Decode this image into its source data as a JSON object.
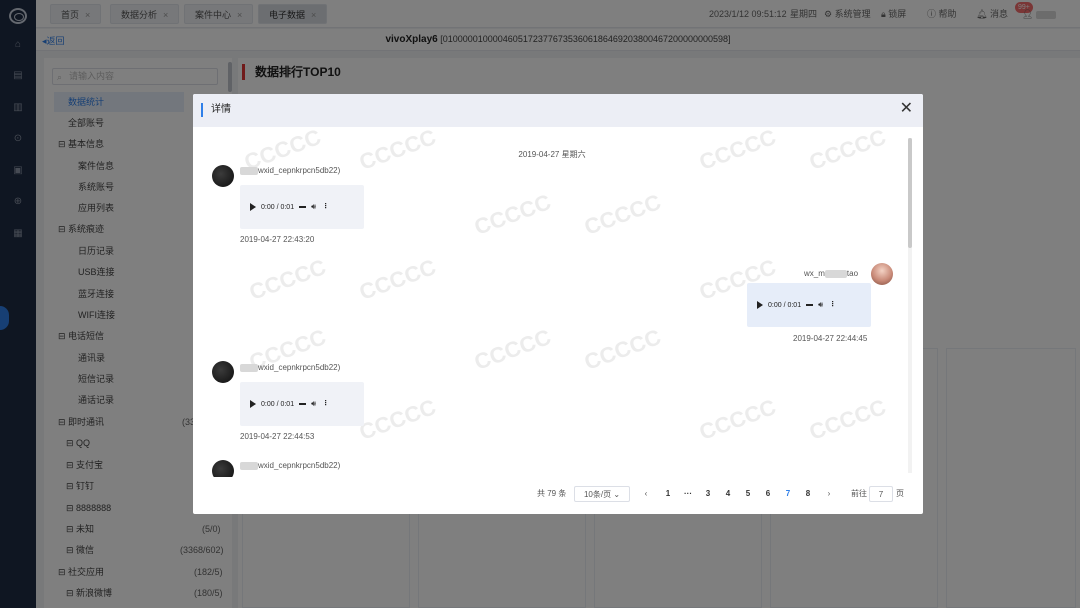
{
  "tabs": [
    {
      "label": "首页",
      "close": "×"
    },
    {
      "label": "数据分析",
      "close": "×"
    },
    {
      "label": "案件中心",
      "close": "×"
    },
    {
      "label": "电子数据",
      "close": "×"
    }
  ],
  "topright": {
    "datetime": "2023/1/12 09:51:12",
    "weekday": "星期四",
    "system": "系统管理",
    "lock": "锁屏",
    "help": "帮助",
    "badge": "99+",
    "message": "消息"
  },
  "subbar": {
    "back": "返回",
    "device_name": "vivoXplay6",
    "device_id": "[010000010000460517237767353606186469203800467200000000598]"
  },
  "search": {
    "placeholder": "请输入内容"
  },
  "tree": [
    {
      "label": "数据统计",
      "count": ""
    },
    {
      "label": "全部账号",
      "count": ""
    },
    {
      "label": "基本信息",
      "count": ""
    },
    {
      "label": "案件信息",
      "count": ""
    },
    {
      "label": "系统账号",
      "count": ""
    },
    {
      "label": "应用列表",
      "count": ""
    },
    {
      "label": "系统痕迹",
      "count": ""
    },
    {
      "label": "日历记录",
      "count": ""
    },
    {
      "label": "USB连接",
      "count": ""
    },
    {
      "label": "蓝牙连接",
      "count": ""
    },
    {
      "label": "WIFI连接",
      "count": ""
    },
    {
      "label": "电话短信",
      "count": ""
    },
    {
      "label": "通讯录",
      "count": ""
    },
    {
      "label": "短信记录",
      "count": ""
    },
    {
      "label": "通话记录",
      "count": ""
    },
    {
      "label": "即时通讯",
      "count": "(33"
    },
    {
      "label": "QQ",
      "count": ""
    },
    {
      "label": "支付宝",
      "count": ""
    },
    {
      "label": "钉钉",
      "count": ""
    },
    {
      "label": "8888888",
      "count": ""
    },
    {
      "label": "未知",
      "count": "(5/0)"
    },
    {
      "label": "微信",
      "count": "(3368/602)"
    },
    {
      "label": "社交应用",
      "count": "(182/5)"
    },
    {
      "label": "新浪微博",
      "count": "(180/5)"
    }
  ],
  "main": {
    "title": "数据排行TOP10"
  },
  "modal": {
    "title": "详情",
    "close": "✕",
    "date_sep": "2019-04-27    星期六",
    "messages": [
      {
        "sender": "wxid_cepnkrpcn5db22)",
        "time_label": "0:00 / 0:01",
        "timestamp": "2019-04-27 22:43:20"
      },
      {
        "sender_prefix": "wx_m",
        "sender_suffix": "tao",
        "time_label": "0:00 / 0:01",
        "timestamp": "2019-04-27 22:44:45"
      },
      {
        "sender": "wxid_cepnkrpcn5db22)",
        "time_label": "0:00 / 0:01",
        "timestamp": "2019-04-27 22:44:53"
      },
      {
        "sender": "wxid_cepnkrpcn5db22)"
      }
    ],
    "watermark": "CCCCC"
  },
  "pager": {
    "total": "共 79 条",
    "page_size": "10条/页",
    "prev": "‹",
    "pages": [
      "1",
      "···",
      "3",
      "4",
      "5",
      "6",
      "7",
      "8"
    ],
    "current": "7",
    "next": "›",
    "goto": "前往",
    "goto_value": "7",
    "page_unit": "页"
  },
  "colors": {
    "accent": "#2f7fe8",
    "rail": "#1f2c44",
    "danger": "#e03535"
  }
}
